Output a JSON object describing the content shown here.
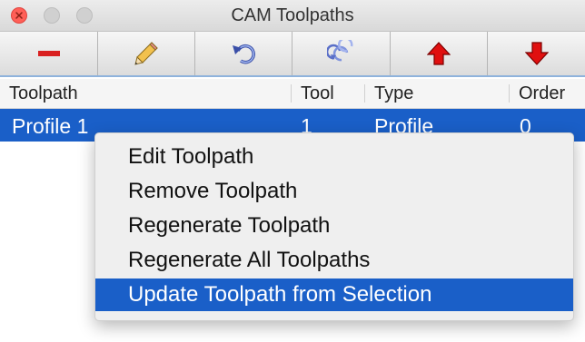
{
  "window": {
    "title": "CAM Toolpaths"
  },
  "toolbar": {
    "buttons": [
      {
        "name": "remove-toolpath-button",
        "icon": "minus-icon"
      },
      {
        "name": "edit-toolpath-button",
        "icon": "pencil-icon"
      },
      {
        "name": "regenerate-toolpath-button",
        "icon": "undo-arrow-icon"
      },
      {
        "name": "regenerate-all-button",
        "icon": "recycle-arrows-icon"
      },
      {
        "name": "move-up-button",
        "icon": "arrow-up-icon"
      },
      {
        "name": "move-down-button",
        "icon": "arrow-down-icon"
      }
    ]
  },
  "table": {
    "columns": [
      "Toolpath",
      "Tool",
      "Type",
      "Order"
    ],
    "rows": [
      {
        "toolpath": "Profile 1",
        "tool": "1",
        "type": "Profile",
        "order": "0"
      }
    ]
  },
  "context_menu": {
    "items": [
      "Edit Toolpath",
      "Remove Toolpath",
      "Regenerate Toolpath",
      "Regenerate All Toolpaths",
      "Update Toolpath from Selection"
    ],
    "selected": "Update Toolpath from Selection"
  },
  "colors": {
    "selection": "#1a5fc8",
    "close_button": "#ff5f57",
    "arrow_red": "#e01010",
    "minus_red": "#d92020"
  }
}
